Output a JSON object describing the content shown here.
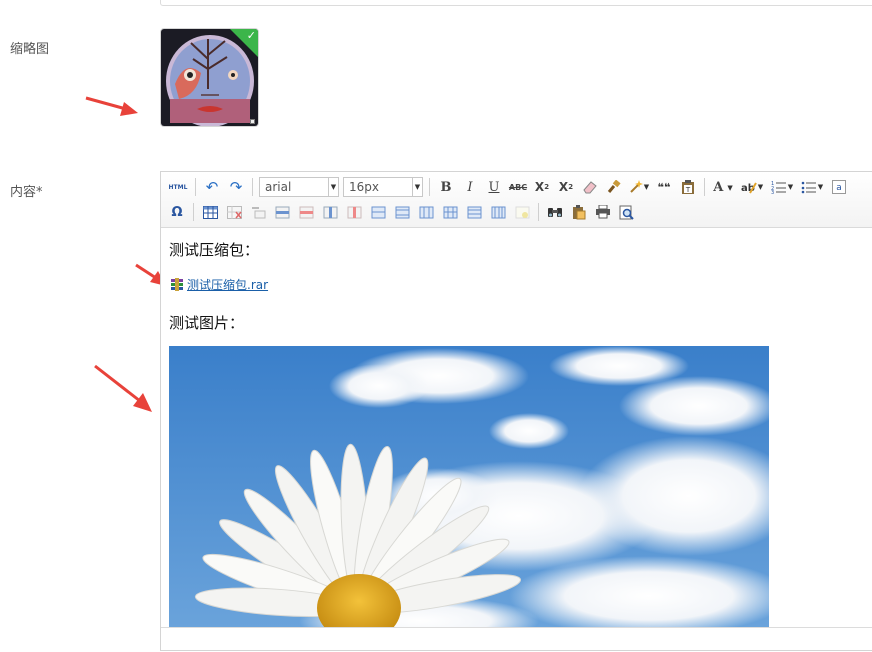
{
  "form": {
    "thumbnail_label": "缩略图",
    "content_label": "内容*"
  },
  "toolbar": {
    "html_label": "HTML",
    "font_family": "arial",
    "font_size": "16px",
    "bold": "B",
    "italic": "I",
    "underline": "U",
    "strikethrough": "ABC",
    "superscript_base": "X",
    "superscript_mark": "2",
    "subscript_base": "X",
    "subscript_mark": "2",
    "quote": "❝❝",
    "font_color": "A",
    "omega": "Ω"
  },
  "editor": {
    "heading_archive": "测试压缩包：",
    "attachment_name": "测试压缩包.rar",
    "heading_image": "测试图片："
  },
  "colors": {
    "arrow": "#e8423a",
    "check": "#3cb54a",
    "link": "#1a5fa8",
    "sky": "#3f86cf"
  }
}
